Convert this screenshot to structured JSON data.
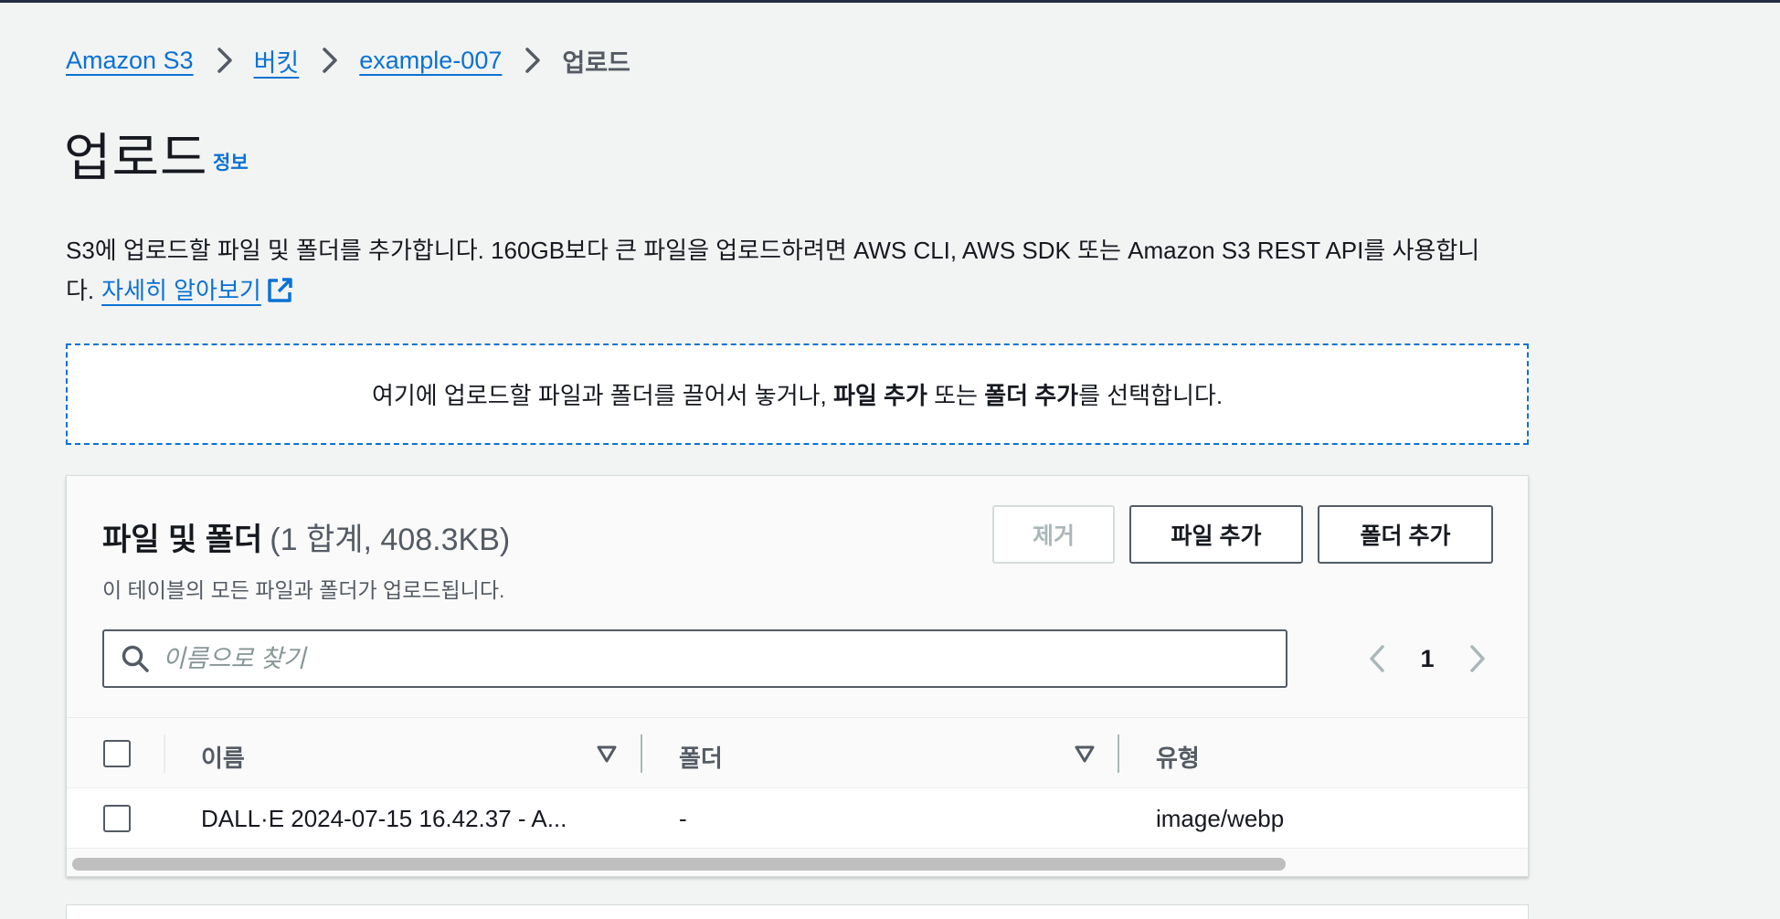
{
  "breadcrumb": {
    "items": [
      "Amazon S3",
      "버킷",
      "example-007"
    ],
    "current": "업로드"
  },
  "header": {
    "title": "업로드",
    "info": "정보"
  },
  "description": {
    "line1": "S3에 업로드할 파일 및 폴더를 추가합니다. 160GB보다 큰 파일을 업로드하려면 AWS CLI, AWS SDK 또는 Amazon S3 REST API를 사용합니",
    "line2": "다.",
    "learn_more": "자세히 알아보기"
  },
  "dropzone": {
    "part1": "여기에 업로드할 파일과 폴더를 끌어서 놓거나, ",
    "bold1": "파일 추가",
    "part2": " 또는 ",
    "bold2": "폴더 추가",
    "part3": "를 선택합니다."
  },
  "files_panel": {
    "title": "파일 및 폴더",
    "count": "(1 합계, 408.3KB)",
    "subtitle": "이 테이블의 모든 파일과 폴더가 업로드됩니다.",
    "buttons": {
      "remove": "제거",
      "add_files": "파일 추가",
      "add_folder": "폴더 추가"
    },
    "search": {
      "placeholder": "이름으로 찾기",
      "value": ""
    },
    "pagination": {
      "current_page": "1"
    },
    "columns": [
      "이름",
      "폴더",
      "유형"
    ],
    "rows": [
      {
        "name": "DALL·E 2024-07-15 16.42.37 - A...",
        "folder": "-",
        "type": "image/webp"
      }
    ]
  },
  "colors": {
    "link": "#0972d3",
    "background": "#f2f3f3",
    "text": "#16191f",
    "muted": "#545b64"
  }
}
